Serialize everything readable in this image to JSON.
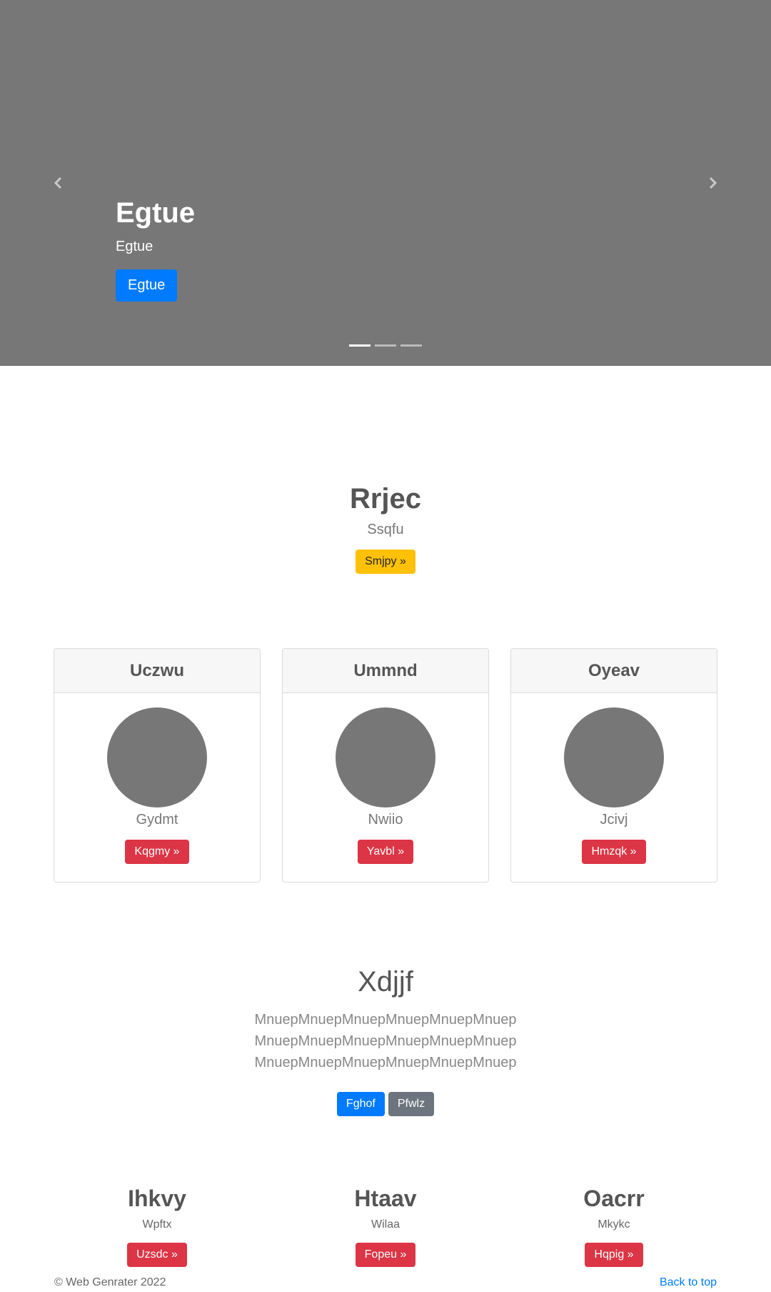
{
  "carousel": {
    "title": "Egtue",
    "subtitle": "Egtue",
    "button": "Egtue",
    "prev_icon": "chevron-left-icon",
    "next_icon": "chevron-right-icon",
    "slides_count": 3,
    "active_slide": 1
  },
  "hero": {
    "title": "Rrjec",
    "subtitle": "Ssqfu",
    "button": "Smjpy »"
  },
  "cards": [
    {
      "title": "Uczwu",
      "text": "Gydmt",
      "button": "Kqgmy »"
    },
    {
      "title": "Ummnd",
      "text": "Nwiio",
      "button": "Yavbl »"
    },
    {
      "title": "Oyeav",
      "text": "Jcivj",
      "button": "Hmzqk »"
    }
  ],
  "section": {
    "title": "Xdjjf",
    "paragraph": "MnuepMnuepMnuepMnuepMnuepMnuepMnuepMnuepMnuepMnuepMnuepMnuepMnuepMnuepMnuepMnuepMnuepMnuep",
    "primary_button": "Fghof",
    "secondary_button": "Pfwlz"
  },
  "columns": [
    {
      "title": "Ihkvy",
      "subtitle": "Wpftx",
      "button": "Uzsdc »"
    },
    {
      "title": "Htaav",
      "subtitle": "Wilaa",
      "button": "Fopeu »"
    },
    {
      "title": "Oacrr",
      "subtitle": "Mkykc",
      "button": "Hqpig »"
    }
  ],
  "footer": {
    "copyright": "© Web Genrater 2022",
    "back_to_top": "Back to top"
  },
  "colors": {
    "placeholder_gray": "#777777",
    "primary": "#007bff",
    "warning": "#ffc107",
    "danger": "#dc3545",
    "secondary": "#6c757d"
  }
}
